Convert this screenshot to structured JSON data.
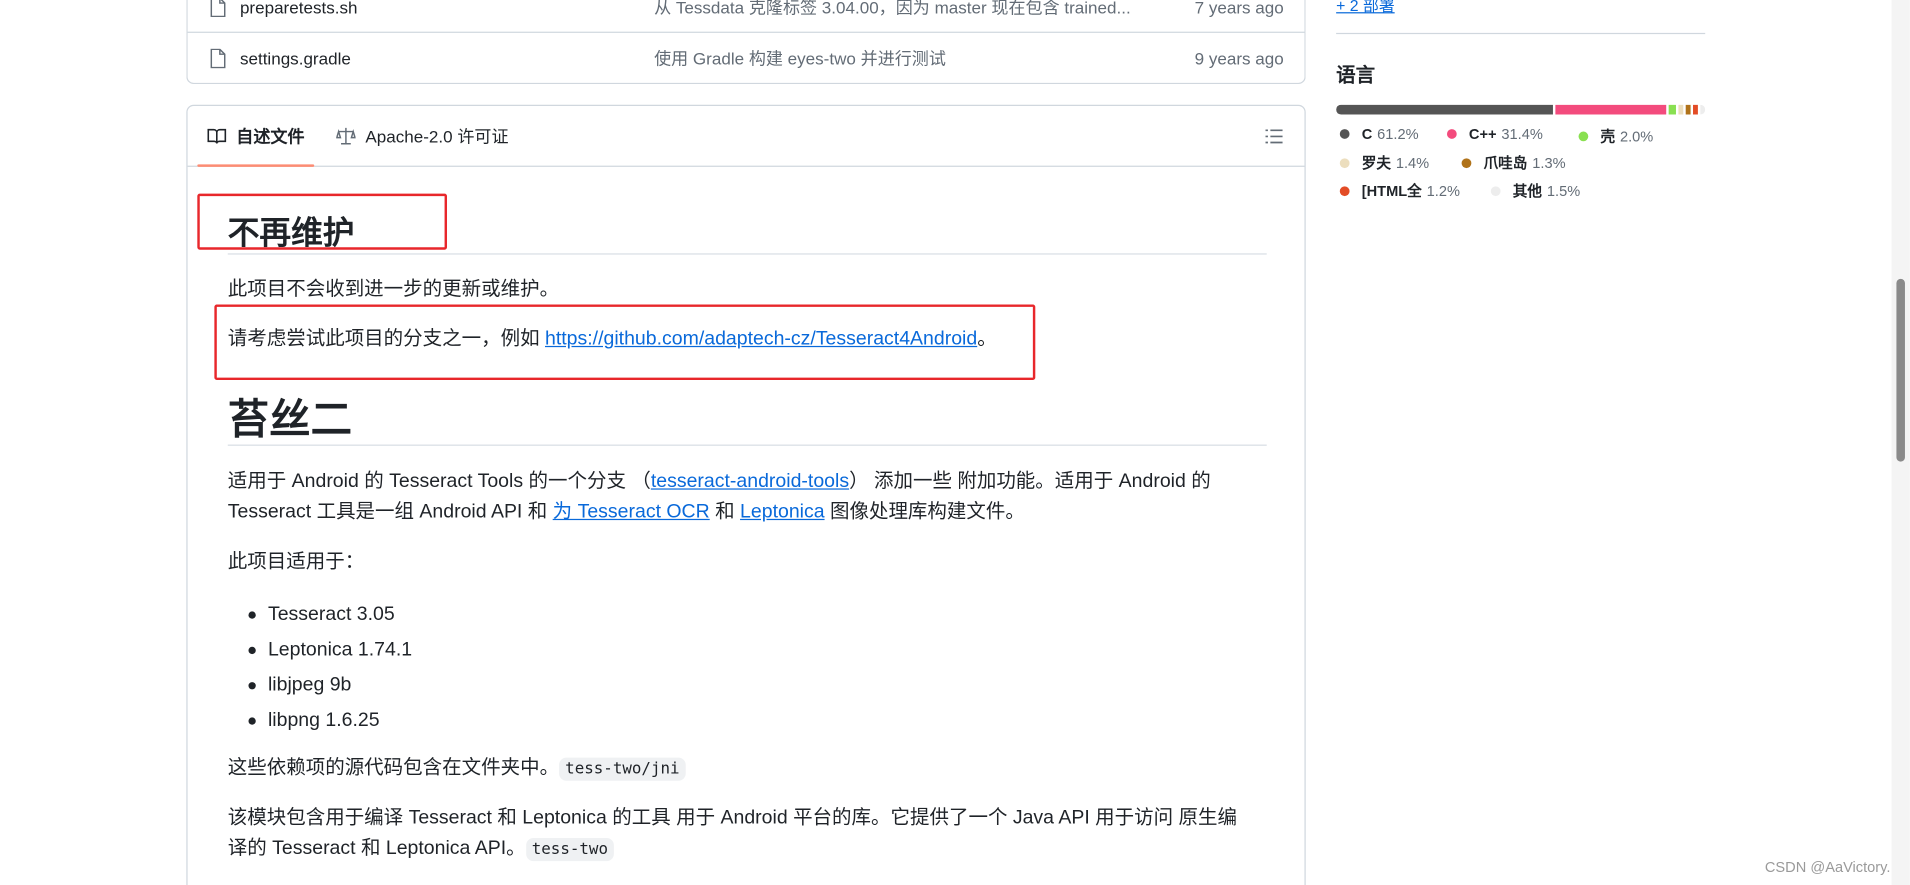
{
  "files": [
    {
      "name": "preparetests.sh",
      "message": "从 Tessdata 克隆标签 3.04.00，因为 master 现在包含 trained...",
      "age": "7 years ago"
    },
    {
      "name": "settings.gradle",
      "message": "使用 Gradle 构建 eyes-two 并进行测试",
      "age": "9 years ago"
    }
  ],
  "tabs": {
    "readme": "自述文件",
    "license": "Apache-2.0 许可证"
  },
  "readme": {
    "h1_unmaintained": "不再维护",
    "p_no_updates": "此项目不会收到进一步的更新或维护。",
    "p_fork_prefix": "请考虑尝试此项目的分支之一，例如 ",
    "p_fork_link": "https://github.com/adaptech-cz/Tesseract4Android",
    "p_fork_suffix": "。",
    "h1_title": "苔丝二",
    "p1_a": "适用于 Android 的 Tesseract Tools 的一个分支 （",
    "p1_link1": "tesseract-android-tools",
    "p1_b": "） 添加一些 附加功能。适用于 Android 的",
    "p1_c": "Tesseract 工具是一组 Android API 和 ",
    "p1_link2": "为 Tesseract OCR",
    "p1_d": " 和 ",
    "p1_link3": "Leptonica",
    "p1_e": " 图像处理库构建文件。",
    "p2": "此项目适用于：",
    "deps": [
      "Tesseract 3.05",
      "Leptonica 1.74.1",
      "libjpeg 9b",
      "libpng 1.6.25"
    ],
    "p3_text": "这些依赖项的源代码包含在文件夹中。",
    "p3_code": "tess-two/jni",
    "p4_a": "该模块包含用于编译 Tesseract 和 Leptonica 的工具 用于 Android 平台的库。它提供了一个 Java API 用于访问 原生编",
    "p4_b": "译的 Tesseract 和 Leptonica API。",
    "p4_code": "tess-two"
  },
  "sidebar": {
    "more_link": "+ 2 部署",
    "languages_title": "语言",
    "languages": [
      {
        "name": "C",
        "percent": "61.2%",
        "value": 61.2,
        "color": "#555555"
      },
      {
        "name": "C++",
        "percent": "31.4%",
        "value": 31.4,
        "color": "#f34b7d"
      },
      {
        "name": "壳",
        "percent": "2.0%",
        "value": 2.0,
        "color": "#89e051"
      },
      {
        "name": "罗夫",
        "percent": "1.4%",
        "value": 1.4,
        "color": "#ecdebe"
      },
      {
        "name": "爪哇岛",
        "percent": "1.3%",
        "value": 1.3,
        "color": "#b07219"
      },
      {
        "name": "[HTML全",
        "percent": "1.2%",
        "value": 1.2,
        "color": "#e34c26"
      },
      {
        "name": "其他",
        "percent": "1.5%",
        "value": 1.5,
        "color": "#ededed"
      }
    ]
  },
  "watermark": "CSDN @AaVictory."
}
